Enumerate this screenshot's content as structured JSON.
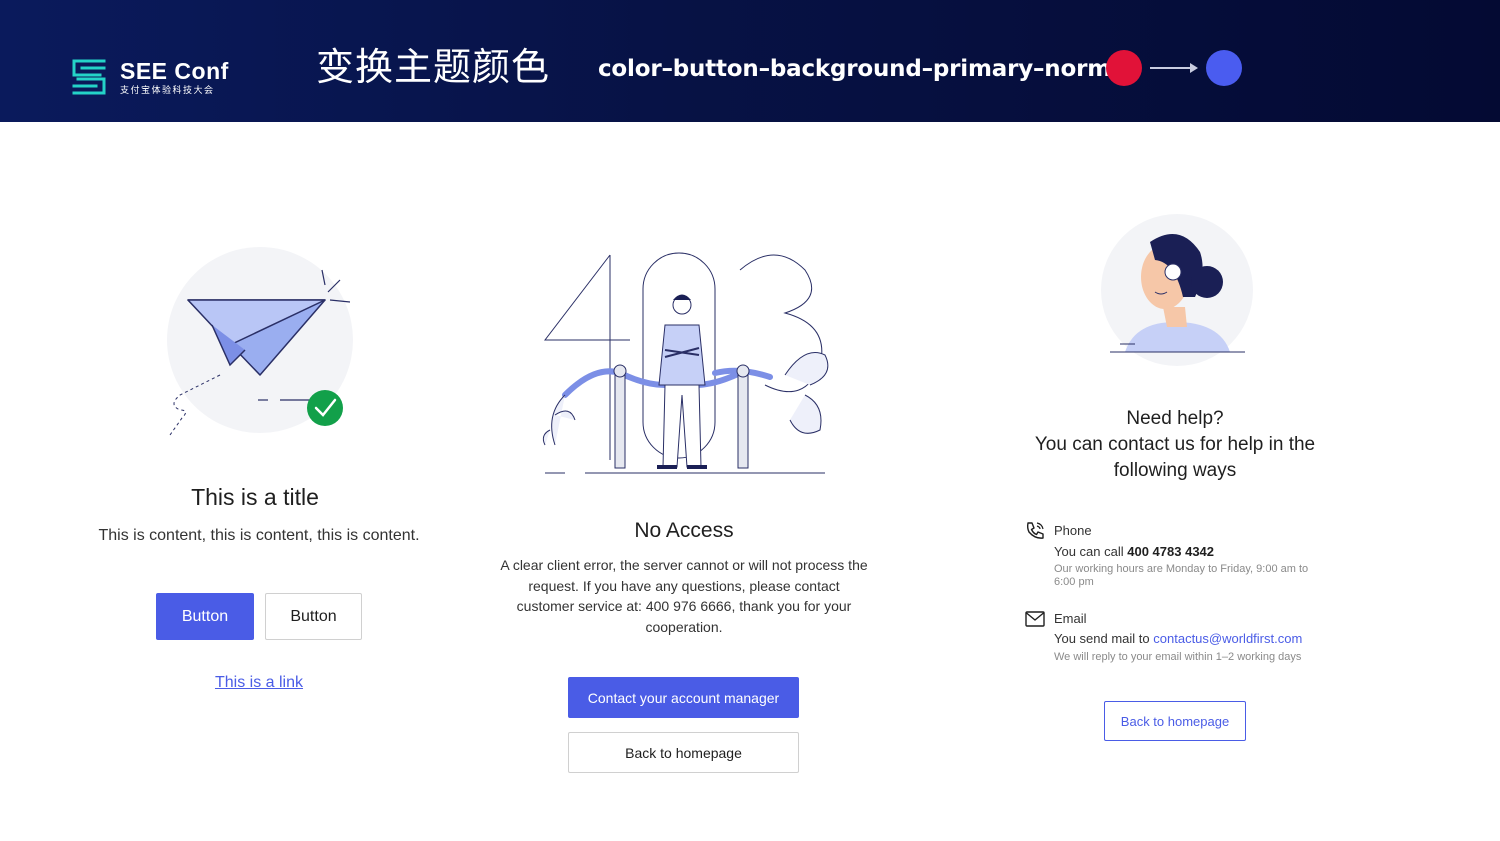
{
  "header": {
    "logo_title": "SEE Conf",
    "logo_subtitle": "支付宝体验科技大会",
    "title_zh": "变换主题颜色",
    "token_name": "color–button–background–primary–normal",
    "from_color": "#e11238",
    "to_color": "#4a5cf0"
  },
  "result_panel": {
    "title": "This is a title",
    "content": "This is content, this is content, this is content.",
    "primary_button": "Button",
    "default_button": "Button",
    "link": "This is a link",
    "icon": "paper-plane-check-icon"
  },
  "forbidden_panel": {
    "title": "No Access",
    "body": "A clear client error, the server cannot or will not process the request. If you have any questions, please contact customer service at: 400 976 6666, thank you for your cooperation.",
    "primary_button": "Contact your account manager",
    "default_button": "Back to homepage",
    "illustration": "403-guard-illustration"
  },
  "help_panel": {
    "heading": "Need help?\nYou can contact us for help in the following ways",
    "phone": {
      "label": "Phone",
      "line_prefix": "You can call ",
      "number": "400 4783 4342",
      "note": "Our working hours are Monday to Friday, 9:00 am to 6:00 pm",
      "icon": "phone-icon"
    },
    "email": {
      "label": "Email",
      "line_prefix": "You send mail to ",
      "address": "contactus@worldfirst.com",
      "note": "We will reply to your email within 1–2 working days",
      "icon": "mail-icon"
    },
    "outline_button": "Back to homepage",
    "illustration": "support-agent-illustration"
  },
  "colors": {
    "primary": "#4a5ce6",
    "header_bg": "#071245",
    "success": "#12a04a"
  }
}
